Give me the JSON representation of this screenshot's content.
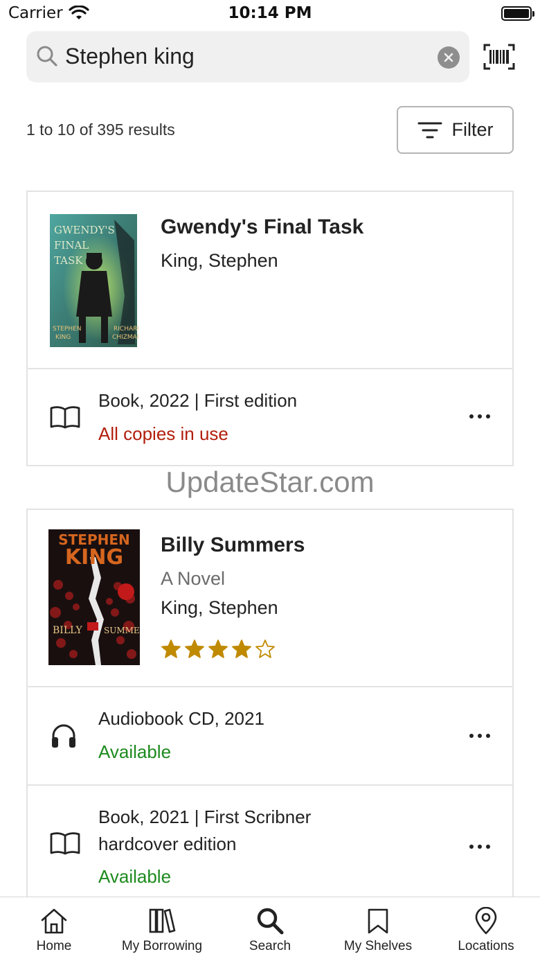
{
  "status_bar": {
    "carrier": "Carrier",
    "time": "10:14 PM"
  },
  "search": {
    "value": "Stephen king"
  },
  "results": {
    "count_text": "1 to 10 of 395 results",
    "filter_label": "Filter"
  },
  "watermark": "UpdateStar.com",
  "items": [
    {
      "title": "Gwendy's Final Task",
      "author": "King, Stephen",
      "cover_icon": "book-cover-gwendys-final-task",
      "formats": [
        {
          "icon": "book-icon",
          "text": "Book, 2022 | First edition",
          "availability": "All copies in use",
          "status": "unavailable"
        }
      ]
    },
    {
      "title": "Billy Summers",
      "subtitle": "A Novel",
      "author": "King, Stephen",
      "rating": 4,
      "rating_max": 5,
      "cover_icon": "book-cover-billy-summers",
      "formats": [
        {
          "icon": "headphones-icon",
          "text": "Audiobook CD, 2021",
          "availability": "Available",
          "status": "available"
        },
        {
          "icon": "book-icon",
          "text": "Book, 2021 | First Scribner hardcover edition",
          "availability": "Available",
          "status": "available"
        }
      ]
    }
  ],
  "colors": {
    "unavailable": "#b21e0c",
    "available": "#1d8a1d",
    "star": "#c08a00"
  },
  "tabs": [
    {
      "label": "Home",
      "icon": "home-icon"
    },
    {
      "label": "My Borrowing",
      "icon": "books-icon"
    },
    {
      "label": "Search",
      "icon": "search-icon"
    },
    {
      "label": "My Shelves",
      "icon": "bookmark-icon"
    },
    {
      "label": "Locations",
      "icon": "location-pin-icon"
    }
  ]
}
